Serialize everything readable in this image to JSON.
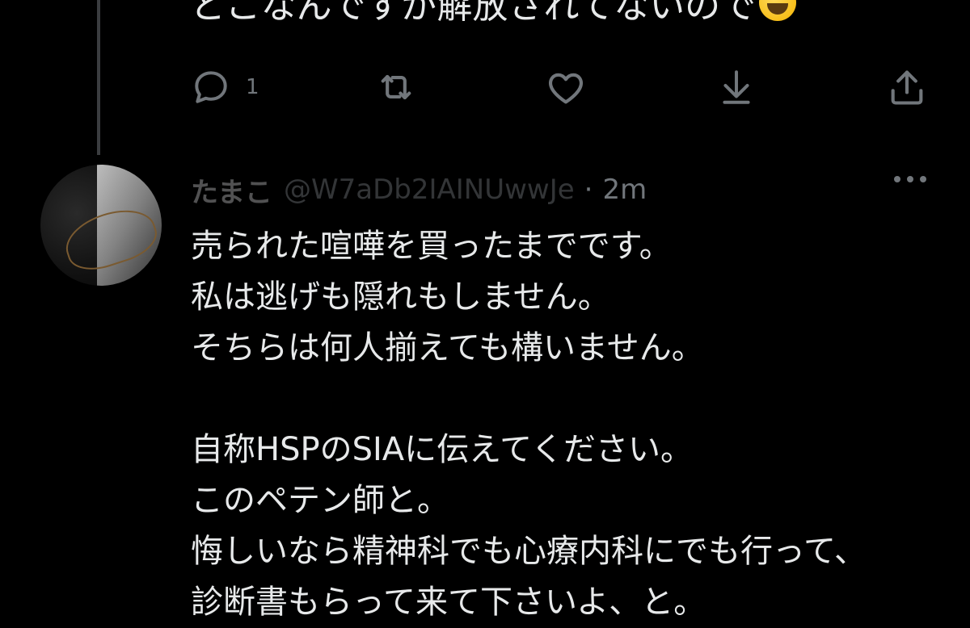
{
  "previous_tweet": {
    "text_tail": "どこなんですが解放されてないので",
    "emoji": "grinning-sweat-emoji",
    "actions": {
      "reply_count": "1",
      "retweet_count": "",
      "like_count": ""
    }
  },
  "reply": {
    "display_name": "たまこ",
    "handle": "@W7aDb2IAINUwwJe",
    "separator": "·",
    "time": "2m",
    "lines": [
      "売られた喧嘩を買ったまでです。",
      "私は逃げも隠れもしません。",
      "そちらは何人揃えても構いません。",
      "",
      "自称HSPのSIAに伝えてください。",
      "このペテン師と。",
      "悔しいなら精神科でも心療内科にでも行って、",
      "診断書もらって来て下さいよ、と。"
    ]
  },
  "colors": {
    "background": "#000000",
    "text": "#e7e9ea",
    "muted": "#71767b",
    "thread_line": "#3b3d40"
  }
}
